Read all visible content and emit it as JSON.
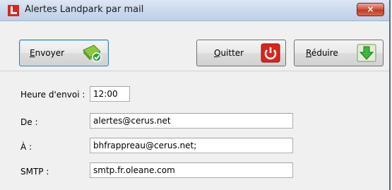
{
  "window": {
    "title": "Alertes Landpark par mail",
    "close_glyph": "×"
  },
  "toolbar": {
    "send": {
      "accel": "E",
      "rest": "nvoyer",
      "icon": "mail-send-icon"
    },
    "quit": {
      "accel": "Q",
      "rest": "uitter",
      "icon": "power-icon"
    },
    "minimize": {
      "accel": "R",
      "rest": "éduire",
      "icon": "green-down-arrow-icon"
    }
  },
  "form": {
    "send_time_label": "Heure d'envoi :",
    "send_time_value": "12:00",
    "from_label": "De :",
    "from_value": "alertes@cerus.net",
    "to_label": "À :",
    "to_value": "bhfrappreau@cerus.net;",
    "smtp_label": "SMTP :",
    "smtp_value": "smtp.fr.oleane.com"
  },
  "colors": {
    "accent_red": "#d9261c",
    "title_bar": "#cbd9ec",
    "close_button": "#c13a24"
  }
}
